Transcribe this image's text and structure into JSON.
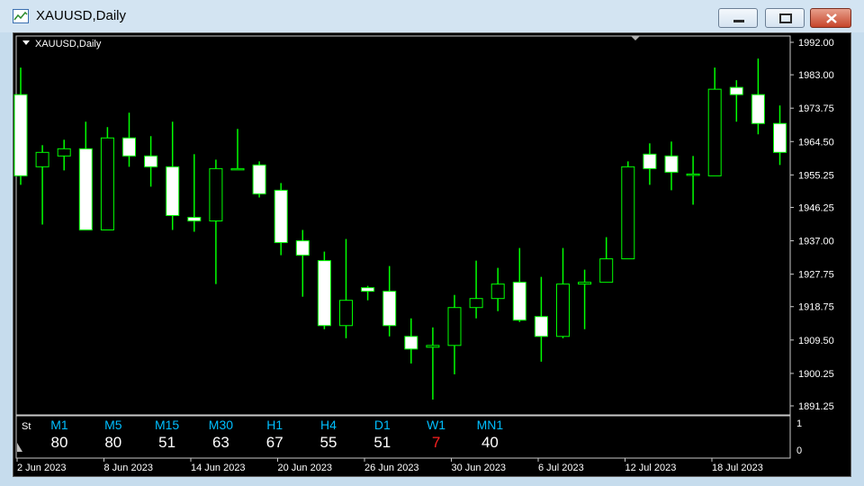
{
  "window": {
    "title": "XAUUSD,Daily",
    "icon": "chart-window-icon",
    "buttons": [
      "minimize-icon",
      "maximize-icon",
      "close-icon"
    ]
  },
  "chart": {
    "label": "XAUUSD,Daily",
    "colors": {
      "background": "#000000",
      "bull_body": "#000000",
      "bear_body": "#ffffff",
      "outline": "#00ff00",
      "axis_text": "#ffffff"
    }
  },
  "indicator": {
    "name": "St",
    "timeframes": [
      {
        "label": "M1",
        "value": "80",
        "color": "#ffffff"
      },
      {
        "label": "M5",
        "value": "80",
        "color": "#ffffff"
      },
      {
        "label": "M15",
        "value": "51",
        "color": "#ffffff"
      },
      {
        "label": "M30",
        "value": "63",
        "color": "#ffffff"
      },
      {
        "label": "H1",
        "value": "67",
        "color": "#ffffff"
      },
      {
        "label": "H4",
        "value": "55",
        "color": "#ffffff"
      },
      {
        "label": "D1",
        "value": "51",
        "color": "#ffffff"
      },
      {
        "label": "W1",
        "value": "7",
        "color": "#ff2020"
      },
      {
        "label": "MN1",
        "value": "40",
        "color": "#ffffff"
      }
    ],
    "scale": [
      "1",
      "0"
    ],
    "label_color": "#00bfff"
  },
  "chart_data": {
    "type": "candlestick",
    "y_ticks": [
      "1992.00",
      "1983.00",
      "1973.75",
      "1964.50",
      "1955.25",
      "1946.25",
      "1937.00",
      "1927.75",
      "1918.75",
      "1909.50",
      "1900.25",
      "1891.25"
    ],
    "y_range": [
      1889.5,
      1993.0
    ],
    "x_labels": [
      "2 Jun 2023",
      "8 Jun 2023",
      "14 Jun 2023",
      "20 Jun 2023",
      "26 Jun 2023",
      "30 Jun 2023",
      "6 Jul 2023",
      "12 Jul 2023",
      "18 Jul 2023"
    ],
    "candles": [
      {
        "o": 1977.5,
        "h": 1985.0,
        "l": 1952.5,
        "c": 1955.0
      },
      {
        "o": 1957.5,
        "h": 1963.5,
        "l": 1941.5,
        "c": 1961.5
      },
      {
        "o": 1960.5,
        "h": 1965.0,
        "l": 1956.5,
        "c": 1962.5
      },
      {
        "o": 1962.5,
        "h": 1970.0,
        "l": 1957.0,
        "c": 1940.0
      },
      {
        "o": 1940.0,
        "h": 1968.5,
        "l": 1940.0,
        "c": 1965.5
      },
      {
        "o": 1965.5,
        "h": 1972.5,
        "l": 1957.5,
        "c": 1960.5
      },
      {
        "o": 1960.5,
        "h": 1966.0,
        "l": 1952.0,
        "c": 1957.5
      },
      {
        "o": 1957.5,
        "h": 1970.0,
        "l": 1940.0,
        "c": 1944.0
      },
      {
        "o": 1943.5,
        "h": 1961.0,
        "l": 1939.5,
        "c": 1942.5
      },
      {
        "o": 1942.5,
        "h": 1959.5,
        "l": 1925.0,
        "c": 1957.0
      },
      {
        "o": 1957.0,
        "h": 1968.0,
        "l": 1957.0,
        "c": 1957.0
      },
      {
        "o": 1958.0,
        "h": 1959.0,
        "l": 1949.0,
        "c": 1950.0
      },
      {
        "o": 1951.0,
        "h": 1953.0,
        "l": 1933.0,
        "c": 1936.5
      },
      {
        "o": 1937.0,
        "h": 1940.0,
        "l": 1921.5,
        "c": 1933.0
      },
      {
        "o": 1931.5,
        "h": 1934.0,
        "l": 1912.5,
        "c": 1913.5
      },
      {
        "o": 1913.5,
        "h": 1937.5,
        "l": 1910.0,
        "c": 1920.5
      },
      {
        "o": 1924.0,
        "h": 1924.5,
        "l": 1920.5,
        "c": 1923.0
      },
      {
        "o": 1923.0,
        "h": 1930.0,
        "l": 1910.5,
        "c": 1913.5
      },
      {
        "o": 1910.5,
        "h": 1915.5,
        "l": 1903.0,
        "c": 1907.0
      },
      {
        "o": 1907.5,
        "h": 1913.0,
        "l": 1893.0,
        "c": 1908.0
      },
      {
        "o": 1908.0,
        "h": 1922.0,
        "l": 1900.0,
        "c": 1918.5
      },
      {
        "o": 1918.5,
        "h": 1931.5,
        "l": 1915.5,
        "c": 1921.0
      },
      {
        "o": 1921.0,
        "h": 1929.5,
        "l": 1917.5,
        "c": 1925.0
      },
      {
        "o": 1925.5,
        "h": 1935.0,
        "l": 1914.5,
        "c": 1915.0
      },
      {
        "o": 1916.0,
        "h": 1927.0,
        "l": 1903.5,
        "c": 1910.5
      },
      {
        "o": 1910.5,
        "h": 1935.0,
        "l": 1910.0,
        "c": 1925.0
      },
      {
        "o": 1925.0,
        "h": 1929.0,
        "l": 1912.5,
        "c": 1925.5
      },
      {
        "o": 1925.5,
        "h": 1938.0,
        "l": 1925.5,
        "c": 1932.0
      },
      {
        "o": 1932.0,
        "h": 1959.0,
        "l": 1932.0,
        "c": 1957.5
      },
      {
        "o": 1961.0,
        "h": 1964.0,
        "l": 1952.5,
        "c": 1957.0
      },
      {
        "o": 1960.5,
        "h": 1964.5,
        "l": 1951.0,
        "c": 1956.0
      },
      {
        "o": 1955.5,
        "h": 1960.5,
        "l": 1947.0,
        "c": 1955.5
      },
      {
        "o": 1955.0,
        "h": 1985.0,
        "l": 1955.0,
        "c": 1979.0
      },
      {
        "o": 1979.5,
        "h": 1981.5,
        "l": 1970.0,
        "c": 1977.5
      },
      {
        "o": 1977.5,
        "h": 1987.5,
        "l": 1966.5,
        "c": 1969.5
      },
      {
        "o": 1969.5,
        "h": 1974.5,
        "l": 1958.0,
        "c": 1961.5
      }
    ]
  }
}
